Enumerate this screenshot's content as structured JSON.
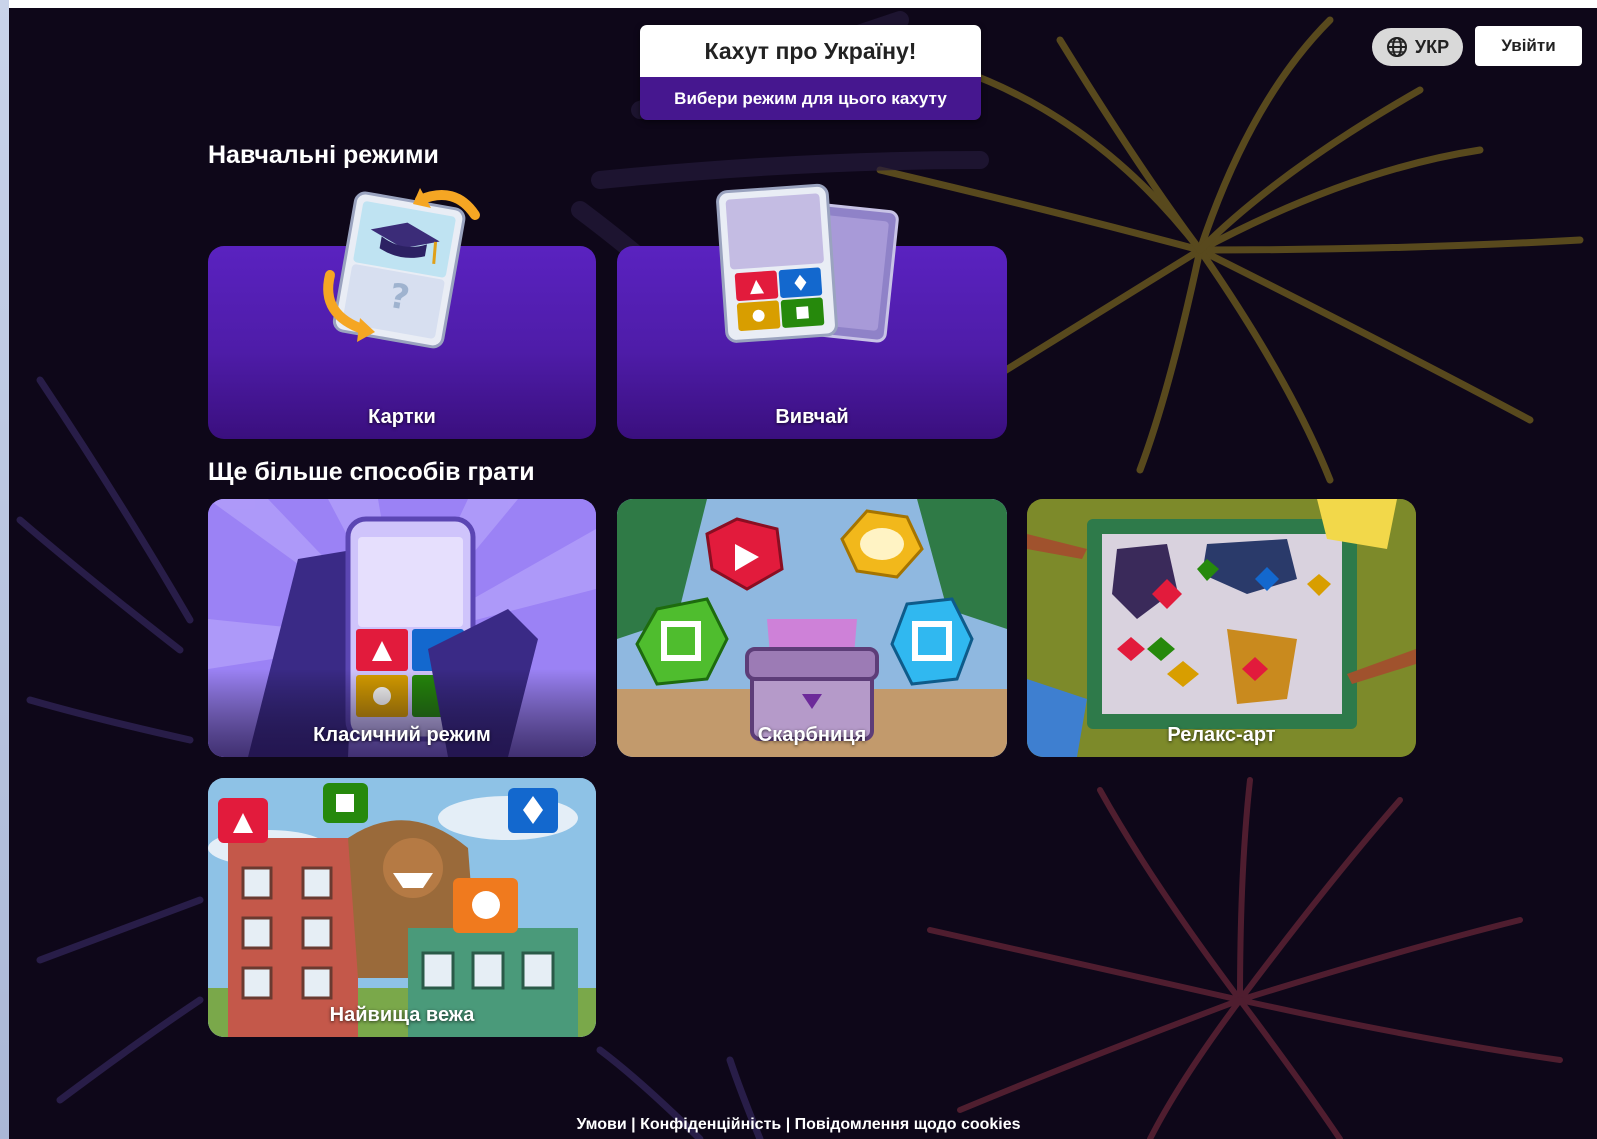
{
  "header": {
    "title": "Кахут про Україну!",
    "subtitle": "Вибери режим для цього кахуту",
    "language_label": "УКР",
    "login_label": "Увійти"
  },
  "study_section": {
    "heading": "Навчальні режими",
    "modes": [
      {
        "label": "Картки",
        "icon": "flashcards-icon"
      },
      {
        "label": "Вивчай",
        "icon": "learn-cards-icon"
      }
    ]
  },
  "play_section": {
    "heading": "Ще більше способів грати",
    "modes": [
      {
        "label": "Класичний режим",
        "icon": "phone-answer-icon"
      },
      {
        "label": "Скарбниця",
        "icon": "treasure-chest-icon"
      },
      {
        "label": "Релакс-арт",
        "icon": "painting-icon"
      },
      {
        "label": "Найвища вежа",
        "icon": "tower-icon"
      }
    ]
  },
  "footer": {
    "terms": "Умови",
    "privacy": "Конфіденційність",
    "cookies": "Повідомлення щодо cookies",
    "separator": "|"
  },
  "colors": {
    "background": "#0e0719",
    "brand_purple": "#46178f",
    "red": "#e21b3c",
    "blue": "#1368ce",
    "yellow": "#d89e00",
    "green": "#26890c"
  }
}
